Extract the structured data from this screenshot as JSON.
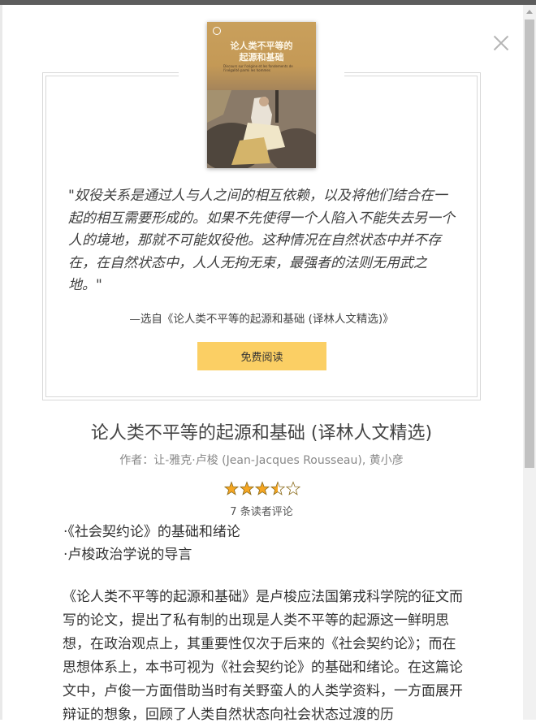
{
  "book": {
    "cover": {
      "title_line1": "论人类不平等的",
      "title_line2": "起源和基础",
      "subtitle": "Discours sur l'origine et les fondements de l'inégalité parmi les hommes"
    },
    "quote": "\"奴役关系是通过人与人之间的相互依赖，以及将他们结合在一起的相互需要形成的。如果不先使得一个人陷入不能失去另一个人的境地，那就不可能奴役他。这种情况在自然状态中并不存在，在自然状态中，人人无拘无束，最强者的法则无用武之地。\"",
    "quote_source": "—选自《论人类不平等的起源和基础 (译林人文精选)》",
    "read_button": "免费阅读",
    "title": "论人类不平等的起源和基础 (译林人文精选)",
    "authors": "作者：让-雅克·卢梭 (Jean-Jacques Rousseau), 黄小彦",
    "rating": 3.5,
    "rating_max": 5,
    "reviews": "7 条读者评论",
    "toc": [
      "·《社会契约论》的基础和绪论",
      "·卢梭政治学说的导言"
    ],
    "description": "《论人类不平等的起源和基础》是卢梭应法国第戎科学院的征文而写的论文，提出了私有制的出现是人类不平等的起源这一鲜明思想，在政治观点上，其重要性仅次于后来的《社会契约论》；而在思想体系上，本书可视为《社会契约论》的基础和绪论。在这篇论文中，卢俊一方面借助当时有关野蛮人的人类学资料，一方面展开辩证的想象，回顾了人类自然状态向社会状态过渡的历"
  },
  "colors": {
    "button": "#fbcf64",
    "star": "#f5a623",
    "scrollbar_thumb": "#c1c1c1",
    "top_bar": "#5d5d5d"
  },
  "icons": {
    "close": "close-icon",
    "star": "star-icon"
  }
}
